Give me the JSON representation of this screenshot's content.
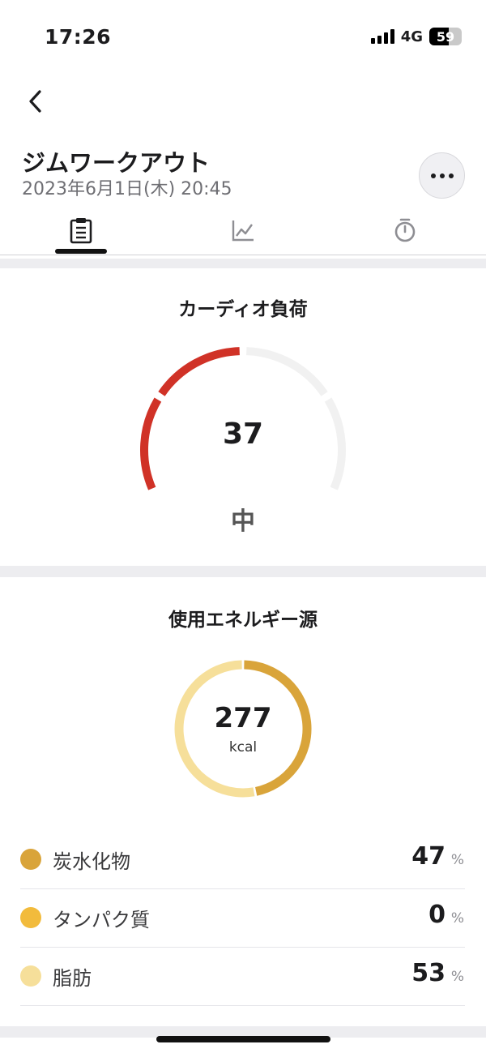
{
  "status_bar": {
    "time": "17:26",
    "network": "4G",
    "battery_percent": "59",
    "battery_level": 0.59
  },
  "header": {
    "title": "ジムワークアウト",
    "datetime": "2023年6月1日(木) 20:45",
    "back_icon": "chevron-left-icon",
    "more_icon": "more-horizontal-icon"
  },
  "tabs": [
    {
      "icon": "clipboard-icon",
      "selected": true
    },
    {
      "icon": "line-chart-icon",
      "selected": false
    },
    {
      "icon": "stopwatch-icon",
      "selected": false
    }
  ],
  "cardio": {
    "title": "カーディオ負荷",
    "value": "37",
    "level": "中",
    "filled_segments": 2,
    "total_segments": 4,
    "colors": {
      "active": "#d03227",
      "inactive": "#f1f1f1"
    }
  },
  "energy": {
    "title": "使用エネルギー源",
    "value": "277",
    "unit": "kcal",
    "sources": [
      {
        "label": "炭水化物",
        "value": "47",
        "unit": "%",
        "percent": 47,
        "color": "#d9a43a"
      },
      {
        "label": "タンパク質",
        "value": "0",
        "unit": "%",
        "percent": 0,
        "color": "#f2bb3c"
      },
      {
        "label": "脂肪",
        "value": "53",
        "unit": "%",
        "percent": 53,
        "color": "#f6df9a"
      }
    ]
  }
}
